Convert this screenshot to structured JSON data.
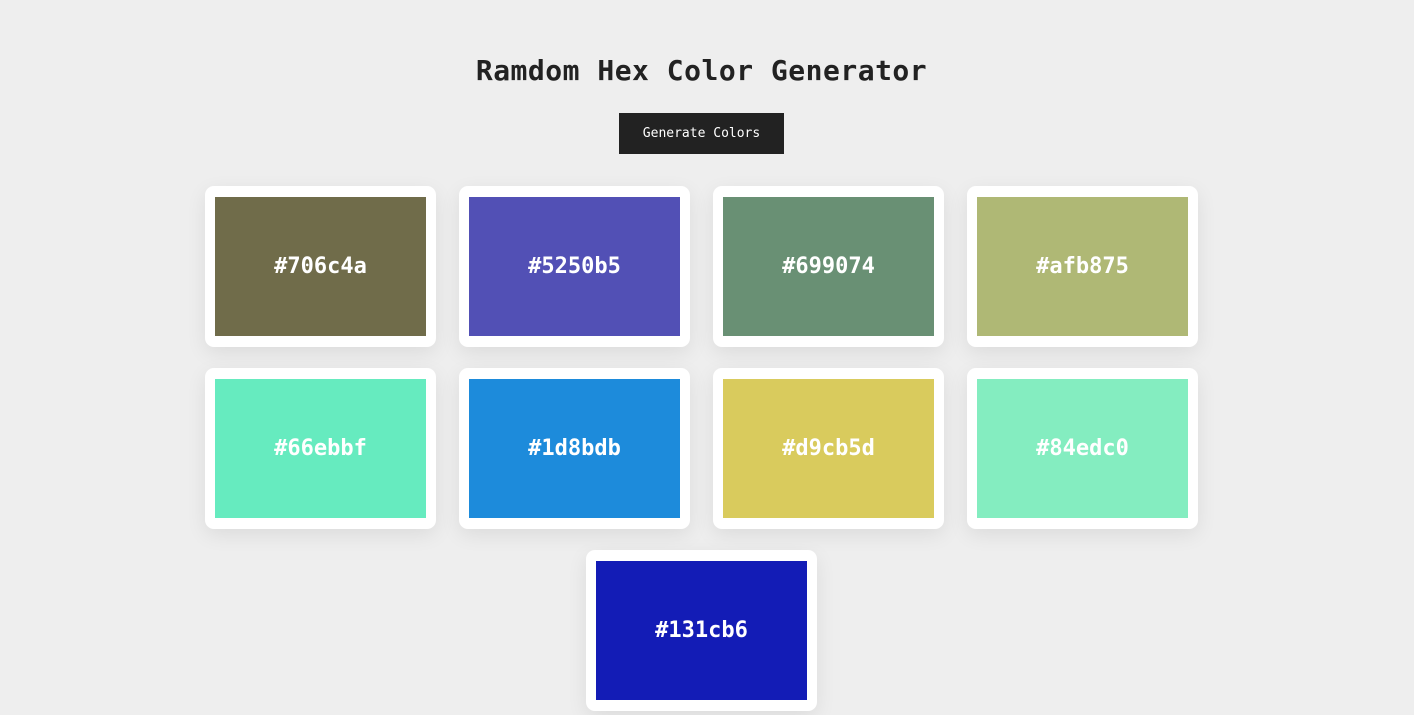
{
  "header": {
    "title": "Ramdom Hex Color Generator"
  },
  "toolbar": {
    "generate_label": "Generate Colors"
  },
  "colors": [
    {
      "hex": "#706c4a"
    },
    {
      "hex": "#5250b5"
    },
    {
      "hex": "#699074"
    },
    {
      "hex": "#afb875"
    },
    {
      "hex": "#66ebbf"
    },
    {
      "hex": "#1d8bdb"
    },
    {
      "hex": "#d9cb5d"
    },
    {
      "hex": "#84edc0"
    },
    {
      "hex": "#131cb6"
    }
  ]
}
